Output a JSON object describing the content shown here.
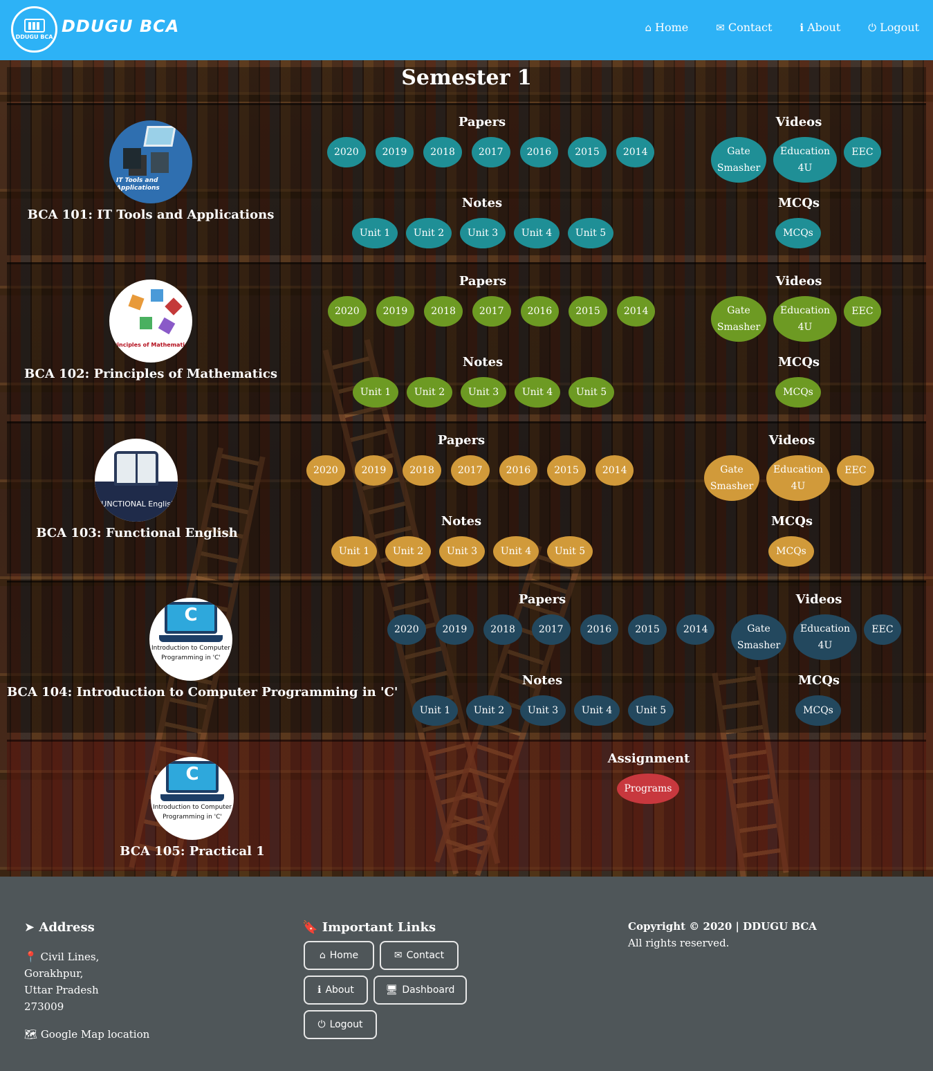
{
  "nav": {
    "brand": "DDUGU BCA",
    "logo_text": "DDUGU BCA",
    "links": [
      {
        "label": "Home",
        "icon": "home-icon"
      },
      {
        "label": "Contact",
        "icon": "envelope-icon"
      },
      {
        "label": "About",
        "icon": "info-icon"
      },
      {
        "label": "Logout",
        "icon": "power-icon"
      }
    ]
  },
  "page_title": "Semester 1",
  "labels": {
    "papers": "Papers",
    "notes": "Notes",
    "videos": "Videos",
    "mcqs": "MCQs",
    "assignment": "Assignment"
  },
  "years": [
    "2020",
    "2019",
    "2018",
    "2017",
    "2016",
    "2015",
    "2014"
  ],
  "units": [
    "Unit 1",
    "Unit 2",
    "Unit 3",
    "Unit 4",
    "Unit 5"
  ],
  "videos": [
    "Gate Smasher",
    "Education 4U",
    "EEC"
  ],
  "mcq_button": "MCQs",
  "courses": [
    {
      "title": "BCA 101: IT Tools and Applications",
      "image_text": "IT Tools and Applications",
      "color": "#1f8f96"
    },
    {
      "title": "BCA 102: Principles of Mathematics",
      "image_text": "Principles of Mathematics",
      "color": "#6d9a23"
    },
    {
      "title": "BCA 103: Functional English",
      "image_text": "FUNCTIONAL English",
      "color": "#d19a3a"
    },
    {
      "title": "BCA 104: Introduction to Computer Programming in 'C'",
      "image_text": "Introduction to Computer Programming in 'C'",
      "color": "#23485e"
    },
    {
      "title": "BCA 105: Practical 1",
      "image_text": "Introduction to Computer Programming in 'C'",
      "color": "#c8383e"
    }
  ],
  "practical_button": "Programs",
  "footer": {
    "address_heading": "Address",
    "address_lines": [
      "Civil Lines,",
      "Gorakhpur,",
      "Uttar Pradesh",
      "273009"
    ],
    "map_link": "Google Map location",
    "links_heading": "Important Links",
    "buttons": [
      "Home",
      "Contact",
      "About",
      "Dashboard",
      "Logout"
    ],
    "copyright": "Copyright © 2020 | DDUGU BCA",
    "rights": "All rights reserved."
  }
}
